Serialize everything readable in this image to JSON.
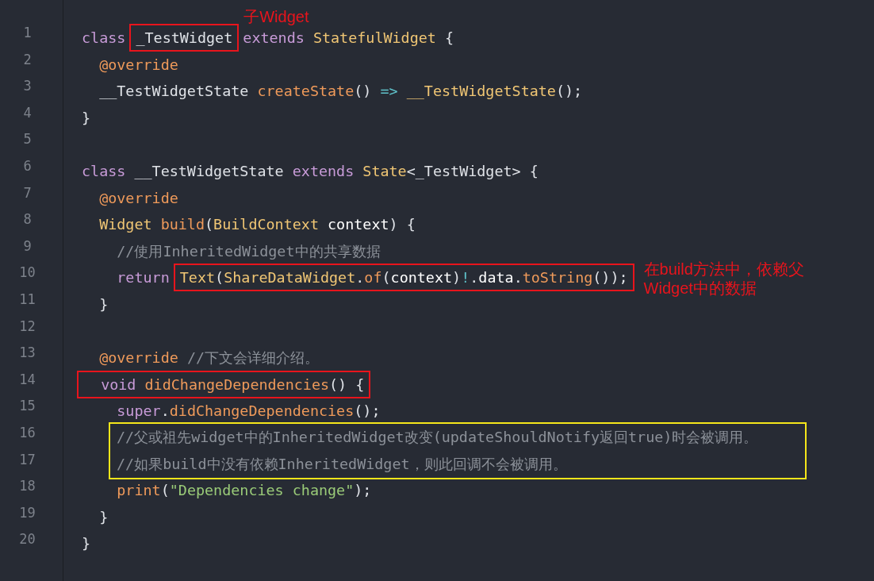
{
  "code": [
    {
      "kind": "line",
      "number": "1",
      "tokens": [
        {
          "text": "class ",
          "kind": "keyword"
        },
        {
          "kind": "box",
          "color": "#e8141c",
          "note": {
            "kind": "above",
            "text": "子Widget"
          },
          "tokens": [
            {
              "text": "_TestWidget",
              "kind": "plain"
            }
          ]
        },
        {
          "text": " extends ",
          "kind": "keyword"
        },
        {
          "text": "StatefulWidget",
          "kind": "type"
        },
        {
          "text": " {",
          "kind": "plain"
        }
      ]
    },
    {
      "kind": "line",
      "number": "2",
      "tokens": [
        {
          "text": "  @override",
          "kind": "annotation"
        }
      ]
    },
    {
      "kind": "line",
      "number": "3",
      "tokens": [
        {
          "text": "  __TestWidgetState ",
          "kind": "plain"
        },
        {
          "text": "createState",
          "kind": "function"
        },
        {
          "text": "() ",
          "kind": "plain"
        },
        {
          "text": "=>",
          "kind": "operator"
        },
        {
          "text": " __TestWidgetState",
          "kind": "type"
        },
        {
          "text": "();",
          "kind": "plain"
        }
      ]
    },
    {
      "kind": "line",
      "number": "4",
      "tokens": [
        {
          "text": "}",
          "kind": "plain"
        }
      ]
    },
    {
      "kind": "line",
      "number": "5"
    },
    {
      "kind": "line",
      "number": "6",
      "tokens": [
        {
          "text": "class ",
          "kind": "keyword"
        },
        {
          "text": "__TestWidgetState ",
          "kind": "plain"
        },
        {
          "text": "extends ",
          "kind": "keyword"
        },
        {
          "text": "State",
          "kind": "type"
        },
        {
          "text": "<_TestWidget> {",
          "kind": "plain"
        }
      ]
    },
    {
      "kind": "line",
      "number": "7",
      "tokens": [
        {
          "text": "  @override",
          "kind": "annotation"
        }
      ]
    },
    {
      "kind": "line",
      "number": "8",
      "tokens": [
        {
          "text": "  Widget ",
          "kind": "type"
        },
        {
          "text": "build",
          "kind": "function"
        },
        {
          "text": "(",
          "kind": "plain"
        },
        {
          "text": "BuildContext ",
          "kind": "type"
        },
        {
          "text": "context",
          "kind": "variable"
        },
        {
          "text": ") {",
          "kind": "plain"
        }
      ]
    },
    {
      "kind": "line",
      "number": "9",
      "tokens": [
        {
          "text": "    //使用InheritedWidget中的共享数据",
          "kind": "comment"
        }
      ]
    },
    {
      "kind": "line",
      "number": "10",
      "tokens": [
        {
          "text": "    return ",
          "kind": "keyword"
        },
        {
          "kind": "box",
          "color": "#e8141c",
          "note": {
            "kind": "side",
            "text": "在build方法中，依赖父\nWidget中的数据"
          },
          "tokens": [
            {
              "text": "Text",
              "kind": "type"
            },
            {
              "text": "(",
              "kind": "plain"
            },
            {
              "text": "ShareDataWidget",
              "kind": "type"
            },
            {
              "text": ".",
              "kind": "plain"
            },
            {
              "text": "of",
              "kind": "function"
            },
            {
              "text": "(",
              "kind": "plain"
            },
            {
              "text": "context",
              "kind": "variable"
            },
            {
              "text": ")",
              "kind": "plain"
            },
            {
              "text": "!",
              "kind": "operator"
            },
            {
              "text": ".",
              "kind": "plain"
            },
            {
              "text": "data",
              "kind": "variable"
            },
            {
              "text": ".",
              "kind": "plain"
            },
            {
              "text": "toString",
              "kind": "function"
            },
            {
              "text": "());",
              "kind": "plain"
            }
          ]
        }
      ]
    },
    {
      "kind": "line",
      "number": "11",
      "tokens": [
        {
          "text": "  }",
          "kind": "plain"
        }
      ]
    },
    {
      "kind": "line",
      "number": "12"
    },
    {
      "kind": "line",
      "number": "13",
      "tokens": [
        {
          "text": "  @override ",
          "kind": "annotation"
        },
        {
          "text": "//下文会详细介绍。",
          "kind": "comment"
        }
      ]
    },
    {
      "kind": "line",
      "number": "14",
      "tokens": [
        {
          "kind": "box",
          "color": "#e8141c",
          "tokens": [
            {
              "text": "  void ",
              "kind": "keyword"
            },
            {
              "text": "didChangeDependencies",
              "kind": "function"
            },
            {
              "text": "() {",
              "kind": "plain"
            }
          ]
        }
      ]
    },
    {
      "kind": "line",
      "number": "15",
      "tokens": [
        {
          "text": "    super",
          "kind": "keyword"
        },
        {
          "text": ".",
          "kind": "plain"
        },
        {
          "text": "didChangeDependencies",
          "kind": "function"
        },
        {
          "text": "();",
          "kind": "plain"
        }
      ]
    },
    {
      "kind": "group",
      "color": "#f5e61a",
      "lines": [
        {
          "kind": "line",
          "number": "16",
          "tokens": [
            {
              "text": "//父或祖先widget中的InheritedWidget改变(updateShouldNotify返回true)时会被调用。",
              "kind": "comment"
            }
          ]
        },
        {
          "kind": "line",
          "number": "17",
          "tokens": [
            {
              "text": "//如果build中没有依赖InheritedWidget，则此回调不会被调用。",
              "kind": "comment"
            }
          ]
        }
      ]
    },
    {
      "kind": "line",
      "number": "18",
      "tokens": [
        {
          "text": "    print",
          "kind": "function"
        },
        {
          "text": "(",
          "kind": "plain"
        },
        {
          "text": "\"Dependencies change\"",
          "kind": "string"
        },
        {
          "text": ");",
          "kind": "plain"
        }
      ]
    },
    {
      "kind": "line",
      "number": "19",
      "tokens": [
        {
          "text": "  }",
          "kind": "plain"
        }
      ]
    },
    {
      "kind": "line",
      "number": "20",
      "tokens": [
        {
          "text": "}",
          "kind": "plain"
        }
      ]
    }
  ]
}
